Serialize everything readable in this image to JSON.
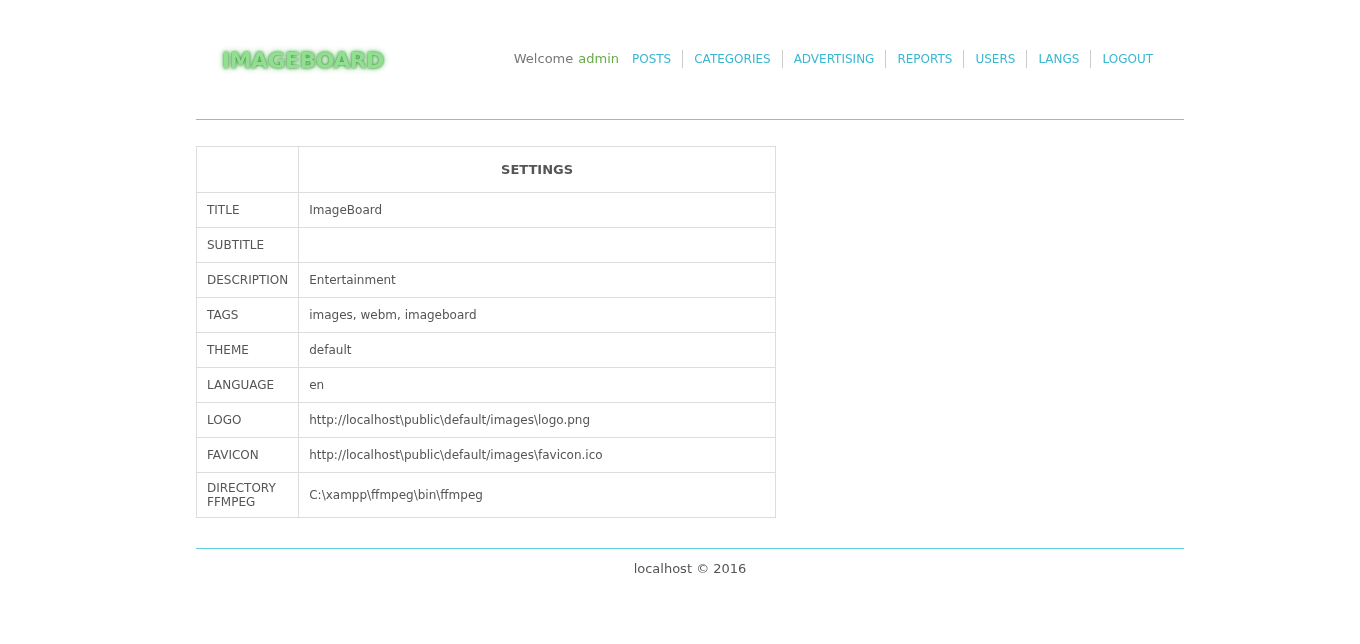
{
  "header": {
    "logo": "IMAGEBOARD",
    "welcome": "Welcome",
    "user": "admin",
    "nav": [
      "POSTS",
      "CATEGORIES",
      "ADVERTISING",
      "REPORTS",
      "USERS",
      "LANGS",
      "LOGOUT"
    ]
  },
  "table": {
    "heading": "SETTINGS",
    "rows": [
      {
        "label": "TITLE",
        "value": "ImageBoard"
      },
      {
        "label": "SUBTITLE"
      },
      {
        "label": "DESCRIPTION",
        "value": "Entertainment"
      },
      {
        "label": "TAGS",
        "value": "images, webm, imageboard"
      },
      {
        "label": "THEME",
        "value": "default"
      },
      {
        "label": "LANGUAGE",
        "value": "en"
      },
      {
        "label": "LOGO",
        "value": "http://localhost\\public\\default/images\\logo.png"
      },
      {
        "label": "FAVICON",
        "value": "http://localhost\\public\\default/images\\favicon.ico"
      },
      {
        "label": "DIRECTORY FFMPEG",
        "value": "C:\\xampp\\ffmpeg\\bin\\ffmpeg"
      }
    ]
  },
  "footer": "localhost © 2016"
}
